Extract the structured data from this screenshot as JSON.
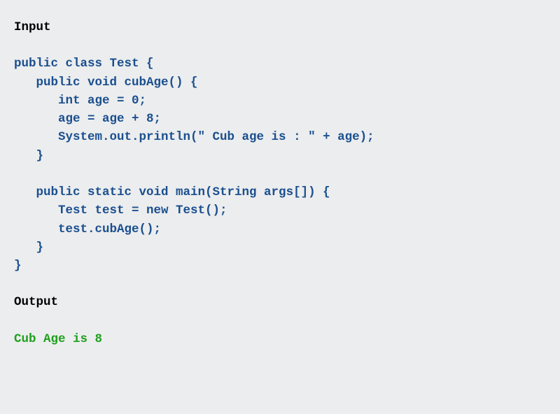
{
  "headings": {
    "input": "Input",
    "output": "Output"
  },
  "code": {
    "lines": [
      "public class Test {",
      "   public void cubAge() {",
      "      int age = 0;",
      "      age = age + 8;",
      "      System.out.println(\" Cub age is : \" + age);",
      "   }",
      "",
      "   public static void main(String args[]) {",
      "      Test test = new Test();",
      "      test.cubAge();",
      "   }",
      "}"
    ]
  },
  "output": {
    "text": "Cub Age is 8"
  }
}
